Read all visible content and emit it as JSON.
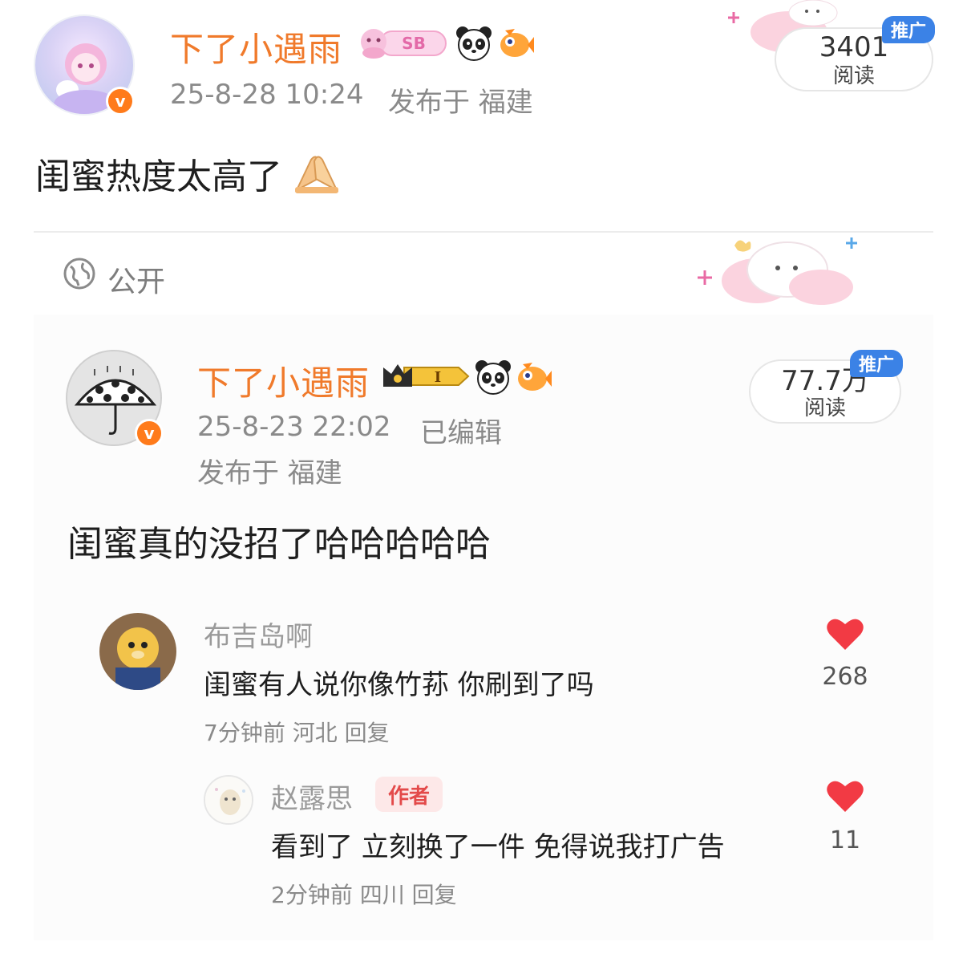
{
  "post": {
    "author": "下了小遇雨",
    "badge_text": "SB",
    "timestamp": "25-8-28 10:24",
    "location": "发布于 福建",
    "text": "闺蜜热度太高了",
    "views_count": "3401",
    "views_label": "阅读",
    "promo_label": "推广",
    "visibility": "公开"
  },
  "quoted_post": {
    "author": "下了小遇雨",
    "level_badge": "I",
    "timestamp": "25-8-23 22:02",
    "edited": "已编辑",
    "location": "发布于 福建",
    "text": "闺蜜真的没招了哈哈哈哈哈",
    "views_count": "77.7万",
    "views_label": "阅读",
    "promo_label": "推广"
  },
  "comments": [
    {
      "name": "布吉岛啊",
      "text": "闺蜜有人说你像竹荪 你刷到了吗",
      "meta": "7分钟前 河北 回复",
      "likes": "268"
    },
    {
      "name": "赵露思",
      "author_tag": "作者",
      "text": "看到了 立刻换了一件 免得说我打广告",
      "meta": "2分钟前 四川 回复",
      "likes": "11"
    }
  ],
  "icons": [
    "verified-v-icon",
    "panda-icon",
    "fish-icon",
    "globe-icon",
    "heart-icon",
    "crown-icon",
    "clasped-hands-emoji"
  ],
  "colors": {
    "username": "#f07a2b",
    "verified": "#ff7b1b",
    "promo": "#3b82e6",
    "heart": "#f23a44",
    "author_tag_bg": "#fde8e8",
    "author_tag_fg": "#e34a4a"
  }
}
